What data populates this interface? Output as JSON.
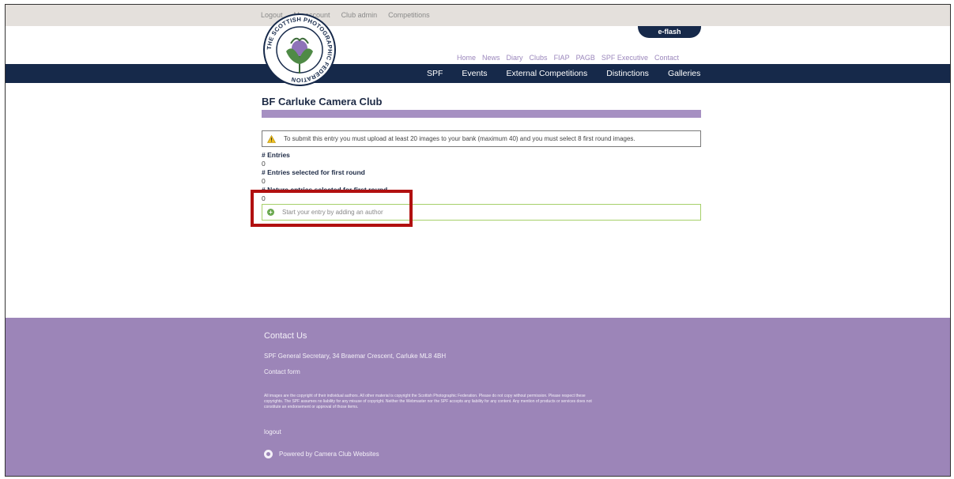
{
  "topbar": {
    "links": [
      "Logout",
      "My account",
      "Club admin",
      "Competitions"
    ]
  },
  "eflash": {
    "label": "e-flash"
  },
  "secondary_nav": {
    "items": [
      "Home",
      "News",
      "Diary",
      "Clubs",
      "FIAP",
      "PAGB",
      "SPF Executive",
      "Contact"
    ]
  },
  "logo": {
    "text": "THE SCOTTISH PHOTOGRAPHIC FEDERATION"
  },
  "main_nav": {
    "items": [
      "SPF",
      "Events",
      "External Competitions",
      "Distinctions",
      "Galleries"
    ]
  },
  "page": {
    "title": "BF Carluke Camera Club",
    "warning": "To submit this entry you must upload at least 20 images to your bank (maximum 40) and you must select 8 first round images.",
    "stats": [
      {
        "label": "# Entries",
        "value": "0"
      },
      {
        "label": "# Entries selected for first round",
        "value": "0"
      },
      {
        "label": "# Nature entries selected for first round",
        "value": "0"
      }
    ],
    "add_author": "Start your entry by adding an author"
  },
  "footer": {
    "contact_heading": "Contact Us",
    "address": "SPF General Secretary, 34 Braemar Crescent, Carluke ML8 4BH",
    "contact_form": "Contact form",
    "legal": "All images are the copyright of their individual authors. All other material is copyright the Scottish Photographic Federation. Please do not copy without permission. Please respect these copyrights. The SPF assumes no liability for any misuse of copyright. Neither the Webmaster nor the SPF accepts any liability for any content. Any mention of products or services does not constitute an endorsement or approval of those items.",
    "logout": "logout",
    "powered_by": "Powered by Camera Club Websites"
  },
  "colors": {
    "navy": "#16294a",
    "purple": "#a690c2",
    "footer_purple": "#9c85b8",
    "highlight_red": "#b11010",
    "success_green": "#6aa84f"
  }
}
